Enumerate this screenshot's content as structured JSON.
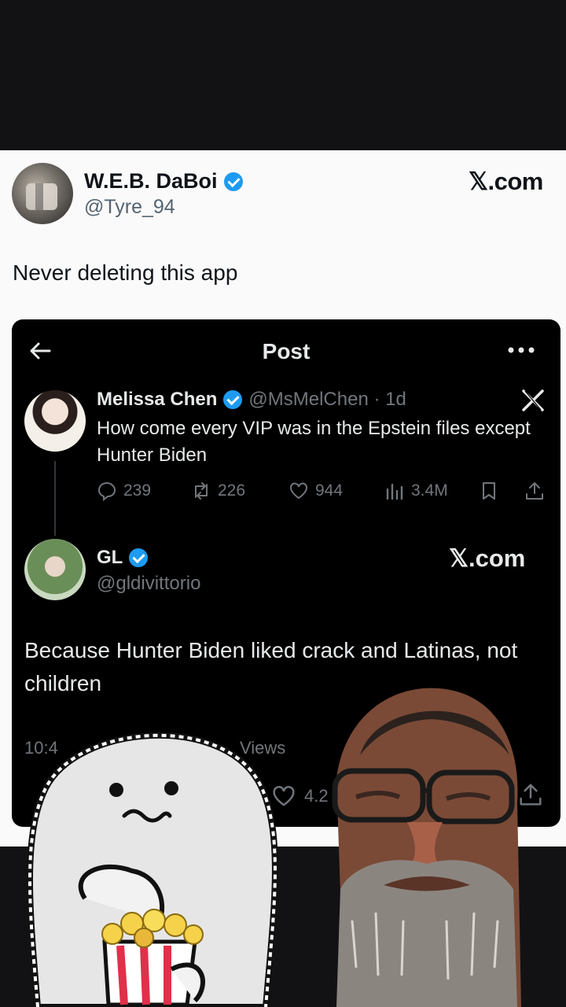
{
  "outer_post": {
    "author_name": "W.E.B. DaBoi",
    "author_handle": "@Tyre_94",
    "brand": "𝕏.com",
    "text": "Never deleting this app"
  },
  "embedded": {
    "header_title": "Post",
    "quoted": {
      "name": "Melissa Chen",
      "handle_time": "@MsMelChen · 1d",
      "text": "How come every VIP was in the Epstein files except Hunter Biden",
      "replies": "239",
      "reposts": "226",
      "likes": "944",
      "views": "3.4M"
    },
    "reply": {
      "name": "GL",
      "handle": "@gldivittorio",
      "brand": "𝕏.com",
      "text": "Because Hunter Biden liked crack and Latinas, not children",
      "time_partial": "10:4",
      "views_label": "Views",
      "likes_partial": "4.2"
    }
  },
  "colors": {
    "verified": "#1d9bf0",
    "dark_bg": "#000000",
    "muted": "#71767b"
  },
  "icons": [
    "back-arrow-icon",
    "more-icon",
    "x-logo-icon",
    "reply-icon",
    "repost-icon",
    "like-icon",
    "views-icon",
    "bookmark-icon",
    "share-icon",
    "verified-icon"
  ]
}
